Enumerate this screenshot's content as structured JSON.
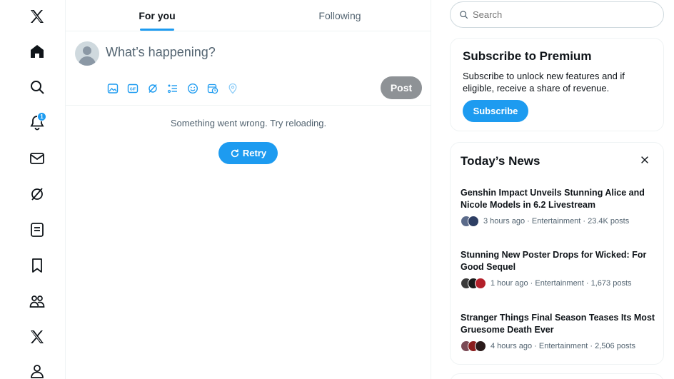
{
  "nav": {
    "items": [
      {
        "name": "x-logo-icon"
      },
      {
        "name": "home-icon"
      },
      {
        "name": "search-icon"
      },
      {
        "name": "notifications-icon",
        "badge": "1"
      },
      {
        "name": "messages-icon"
      },
      {
        "name": "grok-icon"
      },
      {
        "name": "lists-icon"
      },
      {
        "name": "bookmarks-icon"
      },
      {
        "name": "communities-icon"
      },
      {
        "name": "premium-x-icon"
      },
      {
        "name": "profile-icon"
      }
    ]
  },
  "tabs": {
    "for_you": "For you",
    "following": "Following"
  },
  "composer": {
    "placeholder": "What’s happening?",
    "post_label": "Post",
    "tools": [
      "image-icon",
      "gif-icon",
      "grok-icon",
      "poll-icon",
      "emoji-icon",
      "schedule-icon",
      "location-icon"
    ]
  },
  "feed": {
    "error": "Something went wrong. Try reloading.",
    "retry_label": "Retry"
  },
  "search": {
    "placeholder": "Search"
  },
  "premium": {
    "title": "Subscribe to Premium",
    "text": "Subscribe to unlock new features and if eligible, receive a share of revenue.",
    "button": "Subscribe"
  },
  "news": {
    "title": "Today’s News",
    "stories": [
      {
        "headline": "Genshin Impact Unveils Stunning Alice and Nicole Models in 6.2 Livestream",
        "meta": "3 hours ago · Entertainment · 23.4K posts",
        "faces": [
          "#5b6b8a",
          "#2d3e63"
        ]
      },
      {
        "headline": "Stunning New Poster Drops for Wicked: For Good Sequel",
        "meta": "1 hour ago · Entertainment · 1,673 posts",
        "faces": [
          "#3a3a3a",
          "#1a1a1a",
          "#b3202a"
        ]
      },
      {
        "headline": "Stranger Things Final Season Teases Its Most Gruesome Death Ever",
        "meta": "4 hours ago · Entertainment · 2,506 posts",
        "faces": [
          "#7a4a55",
          "#8a1c1c",
          "#2a1a1a"
        ]
      }
    ]
  },
  "colors": {
    "accent": "#1d9bf0",
    "text": "#0f1419",
    "muted": "#536471",
    "post_disabled": "#8e9296"
  }
}
